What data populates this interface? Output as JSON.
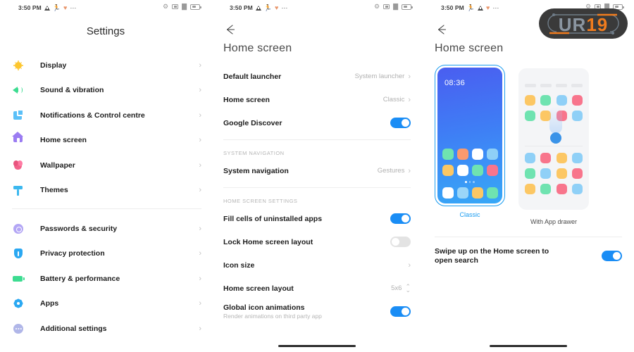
{
  "status_bar": {
    "time": "3:50 PM",
    "left_icons": [
      "warning-triangle-icon",
      "running-person-icon",
      "heart-icon",
      "more-dots-icon"
    ],
    "right_icons": [
      "bluetooth-icon",
      "vibrate-icon",
      "wifi-icon",
      "battery-icon"
    ]
  },
  "panel_settings": {
    "title": "Settings",
    "group_one": [
      {
        "label": "Display",
        "icon": "display-icon"
      },
      {
        "label": "Sound & vibration",
        "icon": "sound-icon"
      },
      {
        "label": "Notifications & Control centre",
        "icon": "notifications-icon"
      },
      {
        "label": "Home screen",
        "icon": "home-screen-icon"
      },
      {
        "label": "Wallpaper",
        "icon": "wallpaper-icon"
      },
      {
        "label": "Themes",
        "icon": "themes-icon"
      }
    ],
    "group_two": [
      {
        "label": "Passwords & security",
        "icon": "passwords-icon"
      },
      {
        "label": "Privacy protection",
        "icon": "privacy-icon"
      },
      {
        "label": "Battery & performance",
        "icon": "battery-icon"
      },
      {
        "label": "Apps",
        "icon": "apps-icon"
      },
      {
        "label": "Additional settings",
        "icon": "additional-settings-icon"
      }
    ]
  },
  "panel_home_screen": {
    "back_icon": "back-arrow-icon",
    "title": "Home screen",
    "top_rows": [
      {
        "label": "Default launcher",
        "value": "System launcher",
        "type": "chevron"
      },
      {
        "label": "Home screen",
        "value": "Classic",
        "type": "chevron"
      },
      {
        "label": "Google Discover",
        "value": "",
        "type": "toggle",
        "toggle": "on"
      }
    ],
    "section_system_navigation": {
      "header": "SYSTEM NAVIGATION",
      "rows": [
        {
          "label": "System navigation",
          "value": "Gestures",
          "type": "chevron"
        }
      ]
    },
    "section_home_screen_settings": {
      "header": "HOME SCREEN SETTINGS",
      "rows": [
        {
          "label": "Fill cells of uninstalled apps",
          "value": "",
          "type": "toggle",
          "toggle": "on"
        },
        {
          "label": "Lock Home screen layout",
          "value": "",
          "type": "toggle",
          "toggle": "off"
        },
        {
          "label": "Icon size",
          "value": "",
          "type": "chevron"
        },
        {
          "label": "Home screen layout",
          "value": "5x6",
          "type": "stepper"
        },
        {
          "label": "Global icon animations",
          "sublabel": "Render animations on third party app",
          "value": "",
          "type": "toggle",
          "toggle": "on"
        }
      ]
    }
  },
  "panel_home_screen_mode": {
    "back_icon": "back-arrow-icon",
    "title": "Home screen",
    "options": [
      {
        "label": "Classic",
        "selected": true,
        "preview_time": "08:36"
      },
      {
        "label": "With App drawer",
        "selected": false
      }
    ],
    "swipe_row": {
      "label": "Swipe up on the Home screen to open search",
      "toggle": "on"
    },
    "watermark": {
      "text": "UR19",
      "colors": [
        "#3c3c3c",
        "#8a95a0",
        "#f07c1e"
      ]
    }
  },
  "colors": {
    "accent_blue": "#1a8df5",
    "toggle_off": "#e3e3e3",
    "text_primary": "#1c1c1c",
    "text_secondary": "#b0b0b0",
    "divider": "#eeeeee"
  },
  "preview_tiles": {
    "classic_rows": [
      [
        "#6fe3b0",
        "#f99a6e",
        "#ffffff",
        "#8fd0f7"
      ],
      [
        "#fcc764",
        "#ffffff",
        "#6fe3b0",
        "#f8758c"
      ],
      [
        "#ffffff",
        "#9bd6f8",
        "#fcc764",
        "#6fe3b0"
      ]
    ],
    "drawer_rows": [
      [
        "#fcc764",
        "#6fe3b0",
        "#8fd0f7",
        "#f8758c"
      ],
      [
        "#6fe3b0",
        "#fcc764",
        "#f8758c",
        "#8fd0f7"
      ],
      [
        "#8fd0f7",
        "#f8758c",
        "#fcc764",
        "#8fd0f7"
      ],
      [
        "#6fe3b0",
        "#8fd0f7",
        "#fcc764",
        "#f8758c"
      ],
      [
        "#fcc764",
        "#6fe3b0",
        "#f8758c",
        "#8fd0f7"
      ]
    ]
  }
}
